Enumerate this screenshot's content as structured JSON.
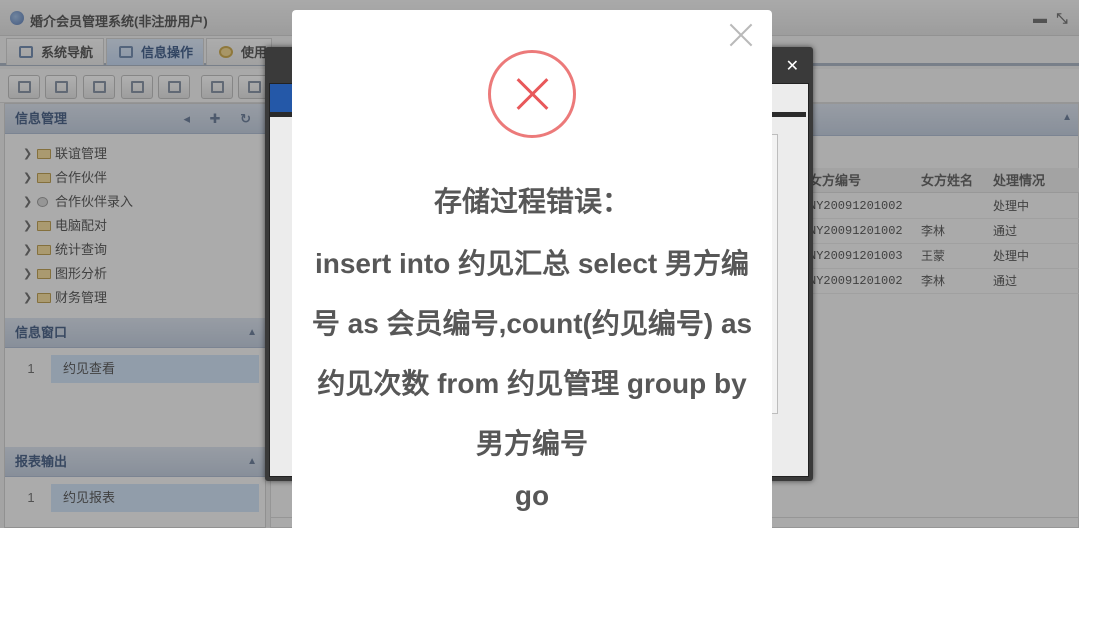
{
  "app": {
    "title": "婚介会员管理系统(非注册用户)"
  },
  "window_controls": {
    "minimize": "▬",
    "restore": "⤡"
  },
  "tabs": [
    {
      "label": "系统导航",
      "active": false
    },
    {
      "label": "信息操作",
      "active": true
    },
    {
      "label": "使用",
      "active": false
    }
  ],
  "sidebar": {
    "info_mgmt": {
      "title": "信息管理",
      "items": [
        "联谊管理",
        "合作伙伴",
        "合作伙伴录入",
        "电脑配对",
        "统计查询",
        "图形分析",
        "财务管理"
      ]
    },
    "info_window": {
      "title": "信息窗口",
      "rows": [
        {
          "num": "1",
          "label": "约见查看"
        }
      ]
    },
    "report_output": {
      "title": "报表输出",
      "rows": [
        {
          "num": "1",
          "label": "约见报表"
        }
      ]
    }
  },
  "grid": {
    "headers": [
      "女方编号",
      "女方姓名",
      "处理情况"
    ],
    "rows": [
      [
        "NY20091201002",
        "",
        "处理中"
      ],
      [
        "NY20091201002",
        "李林",
        "通过"
      ],
      [
        "NY20091201003",
        "王蒙",
        "处理中"
      ],
      [
        "NY20091201002",
        "李林",
        "通过"
      ]
    ]
  },
  "dark_dialog": {
    "controls": "⛶ ✕"
  },
  "alert": {
    "title": "存储过程错误：",
    "message": "insert into 约见汇总 select 男方编号 as 会员编号,count(约见编号) as 约见次数 from 约见管理 group by 男方编号",
    "go": "go"
  },
  "colors": {
    "accent": "#2458a8",
    "error": "#e8585a"
  }
}
